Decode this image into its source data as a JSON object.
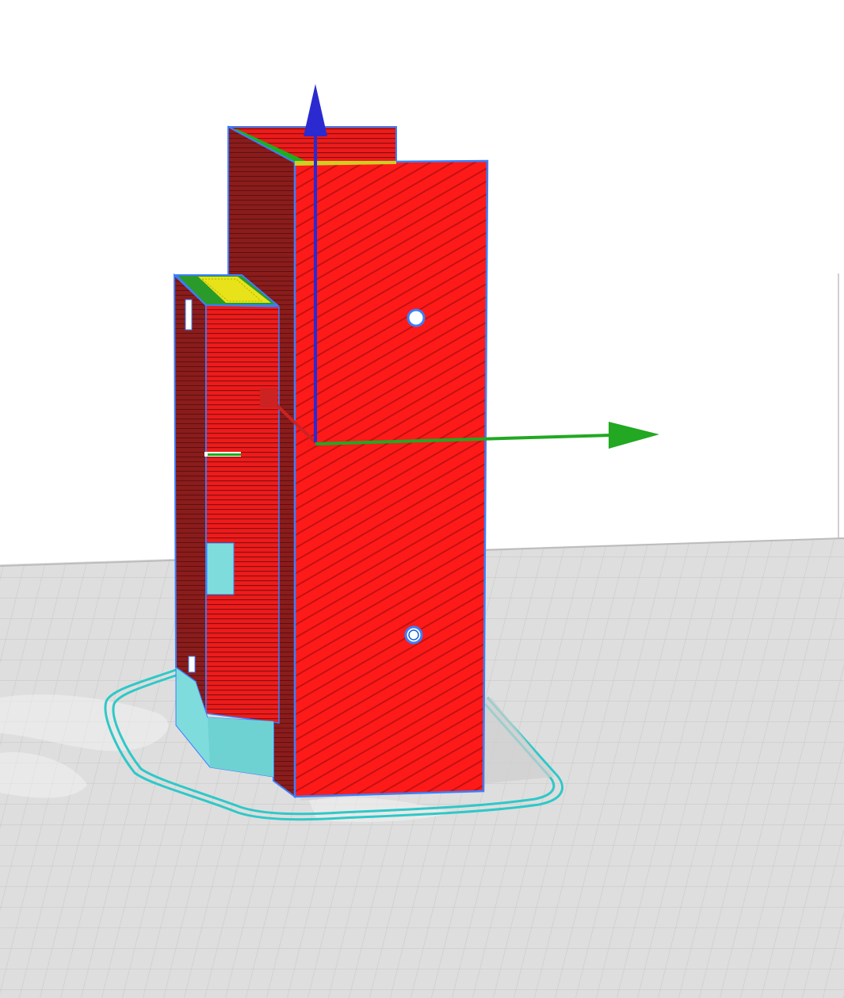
{
  "viewport": {
    "view": "3d-layer-preview",
    "background_color": "#ffffff",
    "build_plate_color": "#dcdcdc",
    "grid_color": "#c4c4c4"
  },
  "model": {
    "wall_color": "#ff1a1a",
    "shadow_wall_color": "#8a1c1c",
    "top_skin_color": "#e8e21a",
    "support_color": "#7fdcdc",
    "skirt_color": "#2fc8c8",
    "outline_color": "#3a7fff"
  },
  "gizmo": {
    "x_axis_color": "#cc2222",
    "y_axis_color": "#22a822",
    "z_axis_color": "#2a2ad0",
    "x_axis_icon": "arrow-x-icon",
    "y_axis_icon": "arrow-y-icon",
    "z_axis_icon": "arrow-z-icon"
  }
}
